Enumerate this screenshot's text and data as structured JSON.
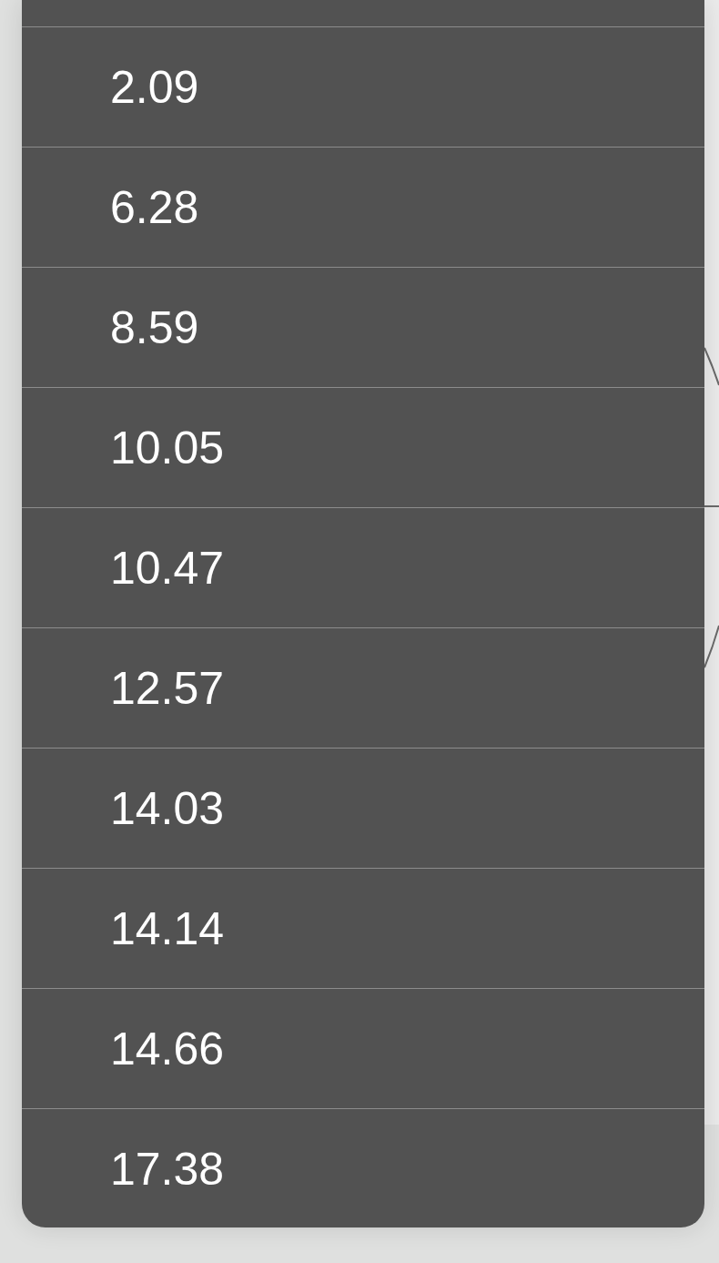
{
  "menu": {
    "items": [
      {
        "label": "2.09"
      },
      {
        "label": "6.28"
      },
      {
        "label": "8.59"
      },
      {
        "label": "10.05"
      },
      {
        "label": "10.47"
      },
      {
        "label": "12.57"
      },
      {
        "label": "14.03"
      },
      {
        "label": "14.14"
      },
      {
        "label": "14.66"
      },
      {
        "label": "17.38"
      }
    ]
  }
}
